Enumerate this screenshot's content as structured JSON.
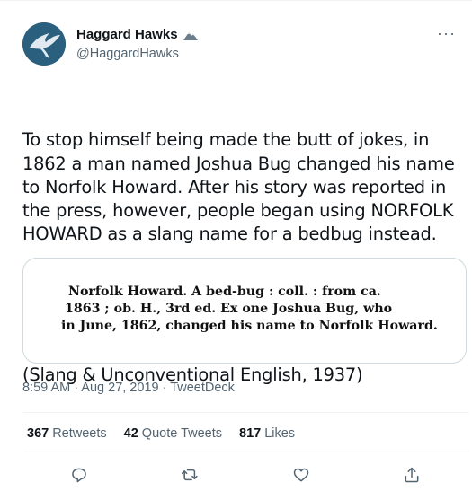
{
  "author": {
    "display_name": "Haggard Hawks",
    "handle": "@HaggardHawks"
  },
  "tweet": {
    "paragraph1": "To stop himself being made the butt of jokes, in 1862 a man named Joshua Bug changed his name to Norfolk Howard. After his story was reported in the press, however, people began using NORFOLK HOWARD as a slang name for a bedbug instead.",
    "paragraph2": "(Slang & Unconventional English, 1937)"
  },
  "media": {
    "line1": "Norfolk Howard.  A bed-bug :  coll. :  from ca.",
    "line2": "1863 ;  ob.   H., 3rd ed.   Ex one Joshua Bug, who",
    "line3": "in June, 1862, changed his name to Norfolk Howard."
  },
  "meta": {
    "time": "8:59 AM",
    "separator": " · ",
    "date": "Aug 27, 2019",
    "source": "TweetDeck"
  },
  "stats": {
    "retweets_count": "367",
    "retweets_label": "Retweets",
    "quotes_count": "42",
    "quotes_label": "Quote Tweets",
    "likes_count": "817",
    "likes_label": "Likes"
  },
  "icons": {
    "more": "more-horizontal-icon",
    "reply": "reply-icon",
    "retweet": "retweet-icon",
    "like": "heart-icon",
    "share": "share-icon"
  },
  "colors": {
    "text_primary": "#0f1419",
    "text_secondary": "#536471",
    "border": "#cfd9de",
    "avatar_bg": "#2a5f7e"
  }
}
